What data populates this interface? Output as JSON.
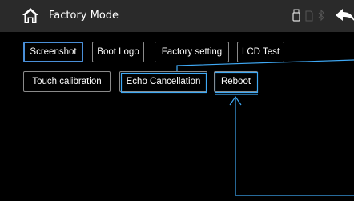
{
  "header": {
    "title": "Factory Mode",
    "home_icon": "home-icon",
    "status_icons": [
      "usb-icon",
      "sd-card-icon",
      "bluetooth-icon"
    ],
    "back_icon": "back-arrow-icon"
  },
  "buttons": {
    "screenshot": "Screenshot",
    "boot_logo": "Boot Logo",
    "factory_setting": "Factory setting",
    "lcd_test": "LCD Test",
    "touch_calibration": "Touch calibration",
    "echo_cancellation": "Echo Cancellation",
    "reboot": "Reboot"
  },
  "colors": {
    "background": "#000000",
    "header": "#2a2a2a",
    "highlight": "#4a8fd8",
    "annotation": "#3fa9f5"
  }
}
